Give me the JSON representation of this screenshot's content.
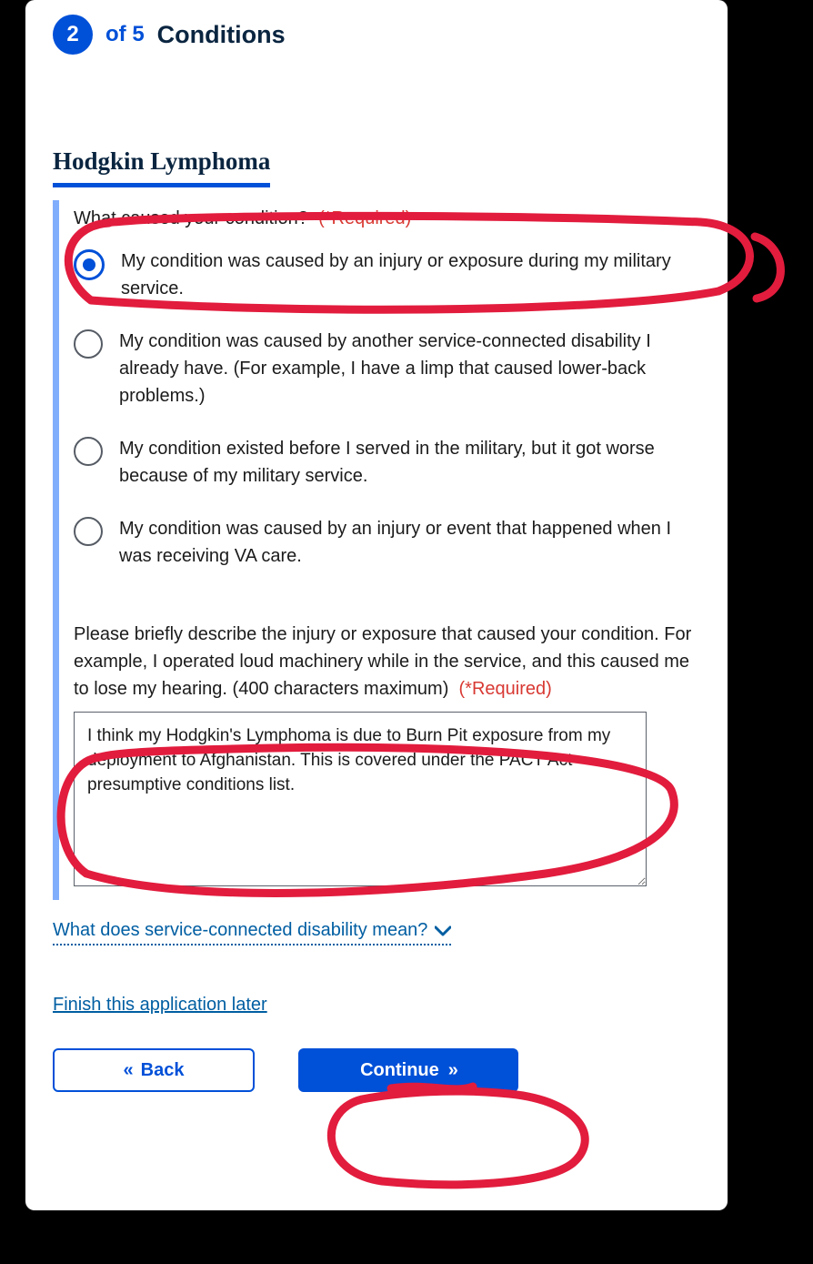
{
  "progress": {
    "current_step": "2",
    "of_text": "of 5",
    "section_name": "Conditions"
  },
  "section": {
    "title": "Hodgkin Lymphoma"
  },
  "cause": {
    "legend": "What caused your condition?",
    "required_label": "(*Required)",
    "options": [
      "My condition was caused by an injury or exposure during my military service.",
      "My condition was caused by another service-connected disability I already have. (For example, I have a limp that caused lower-back problems.)",
      "My condition existed before I served in the military, but it got worse because of my military service.",
      "My condition was caused by an injury or event that happened when I was receiving VA care."
    ],
    "selected_index": 0
  },
  "description": {
    "prompt": "Please briefly describe the injury or exposure that caused your condition. For example, I operated loud machinery while in the service, and this caused me to lose my hearing. (400 characters maximum)",
    "required_label": "(*Required)",
    "value": "I think my Hodgkin's Lymphoma is due to Burn Pit exposure from my deployment to Afghanistan. This is covered under the PACT Act presumptive conditions list."
  },
  "expander": {
    "label": "What does service-connected disability mean?"
  },
  "finish_link": "Finish this application later",
  "buttons": {
    "back": "Back",
    "continue": "Continue"
  }
}
